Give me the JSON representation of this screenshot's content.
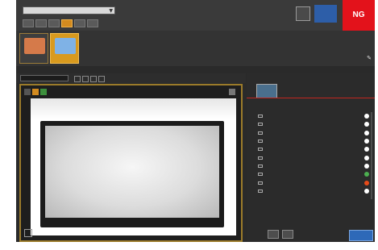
{
  "header": {
    "selector_value": "",
    "info_rows": [
      [
        "",
        "",
        "",
        "",
        ""
      ],
      [
        "",
        "",
        "",
        "",
        ""
      ],
      [
        "",
        "",
        "",
        "",
        ""
      ],
      [
        "",
        "",
        "",
        "",
        ""
      ]
    ],
    "blue_button_label": "",
    "status": "NG",
    "colors": {
      "status": "#e3121b",
      "accent": "#d99a1e",
      "highlight": "#2e69b8"
    }
  },
  "thumbnails": [
    {
      "label": "",
      "active": false,
      "folder_color": "#d57a4a"
    },
    {
      "label": "",
      "active": true,
      "folder_color": "#7fb2e6"
    }
  ],
  "viewer": {
    "dropdown_value": "",
    "icons": [
      "top-left-icon",
      "orange-flag-icon",
      "green-flag-icon",
      "bottom-corner-icon"
    ]
  },
  "right_panel": {
    "model_label": "",
    "model_name": "",
    "model_sub": "",
    "model_meta": "",
    "header_left": "",
    "header_right": "",
    "items": [
      {
        "label": "",
        "status_color": "#ffffff"
      },
      {
        "label": "",
        "status_color": "#ffffff"
      },
      {
        "label": "",
        "status_color": "#ffffff"
      },
      {
        "label": "",
        "status_color": "#ffffff"
      },
      {
        "label": "",
        "status_color": "#ffffff"
      },
      {
        "label": "",
        "status_color": "#ffffff"
      },
      {
        "label": "",
        "status_color": "#ffffff"
      },
      {
        "label": "",
        "status_color": "#4caf50"
      },
      {
        "label": "",
        "status_color": "#e64a19"
      },
      {
        "label": "",
        "status_color": "#ffffff"
      }
    ],
    "run_label": ""
  }
}
